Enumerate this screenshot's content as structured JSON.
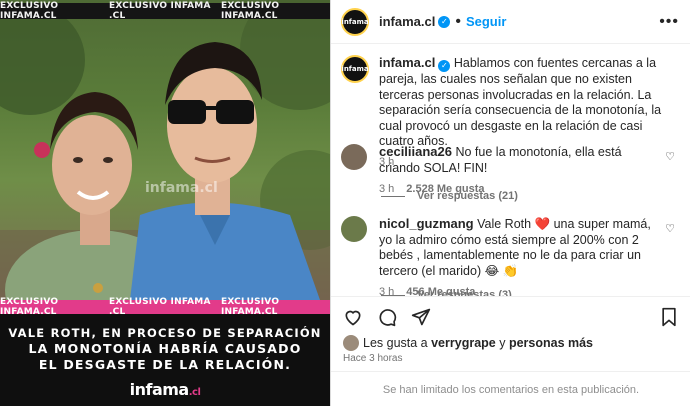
{
  "media": {
    "watermarks": [
      "EXCLUSIVO INFAMA.CL",
      "EXCLUSIVO INFAMA .CL",
      "EXCLUSIVO INFAMA.CL"
    ],
    "headline_lines": [
      "VALE ROTH, EN PROCESO DE SEPARACIÓN",
      "LA MONOTONÍA HABRÍA CAUSADO",
      "EL DESGASTE DE LA RELACIÓN."
    ],
    "photo_watermark": "infama.cl",
    "logo": "infama",
    "logo_suffix": ".cl",
    "accent": "#e23b8a"
  },
  "header": {
    "avatar_text": "infama",
    "username": "infama.cl",
    "verified_icon": "verified-badge-icon",
    "separator": "•",
    "follow_label": "Seguir",
    "more_icon": "more-options-icon"
  },
  "caption": {
    "username": "infama.cl",
    "text": "Hablamos con fuentes cercanas a la pareja, las cuales nos señalan que no existen terceras personas involucradas en la relación. La separación sería consecuencia de la monotonía, la cual provocó un desgaste en la relación de casi cuatro años.",
    "time": "3 h"
  },
  "comments": [
    {
      "username": "ceciliiana26",
      "text": "No fue la monotonía, ella está criando SOLA! FIN!",
      "time": "3 h",
      "likes": "2.528 Me gusta",
      "replies": "Ver respuestas (21)",
      "avatar_color": "#7a6a5a"
    },
    {
      "username": "nicol_guzmang",
      "text": "Vale Roth ❤️ una super mamá, yo la admiro cómo está siempre al 200% con 2 bebés , lamentablemente no le da para criar un tercero (el marido) 😂 👏",
      "time": "3 h",
      "likes": "456 Me gusta",
      "replies": "Ver respuestas (3)",
      "avatar_color": "#6b7a4a"
    }
  ],
  "actions": {
    "likes_prefix": "Les gusta a ",
    "likes_user": "verrygrape",
    "likes_and": " y ",
    "likes_more": "personas más",
    "post_time": "Hace 3 horas",
    "comments_limited": "Se han limitado los comentarios en esta publicación."
  },
  "colors": {
    "link_blue": "#0095f6",
    "muted": "#737373"
  }
}
